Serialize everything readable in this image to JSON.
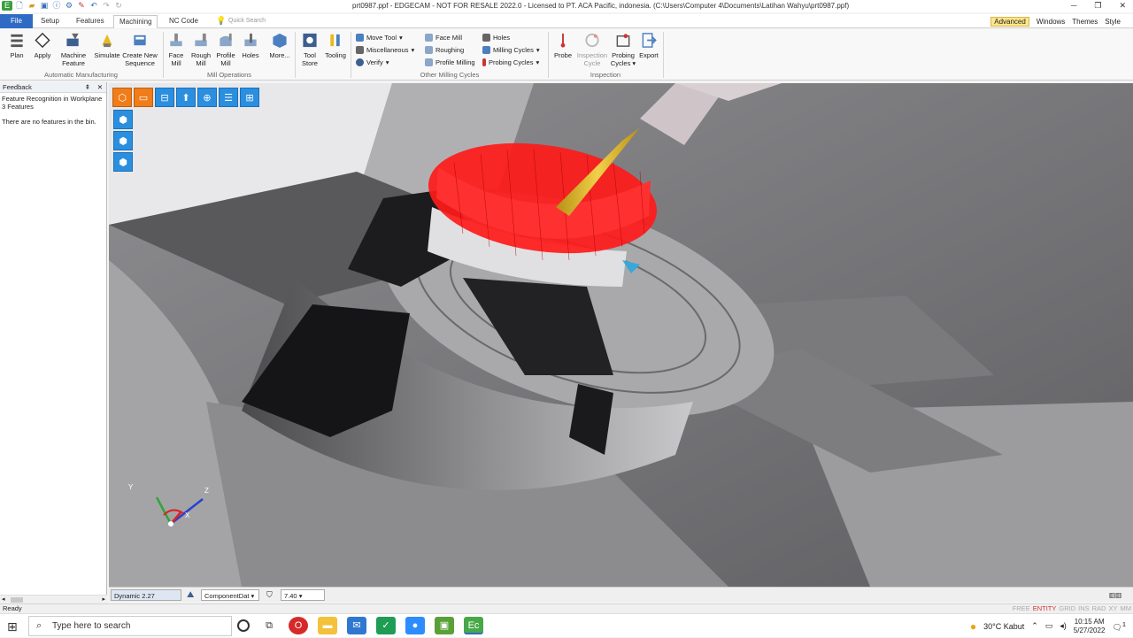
{
  "window": {
    "title": "prt0987.ppf - EDGECAM - NOT FOR RESALE 2022.0  - Licensed to PT. ACA Pacific, indonesia. (C:\\Users\\Computer 4\\Documents\\Latihan Wahyu\\prt0987.ppf)",
    "minimize": "─",
    "maximize": "❐",
    "close": "✕"
  },
  "tabs": {
    "file": "File",
    "setup": "Setup",
    "features": "Features",
    "machining": "Machining",
    "nc_code": "NC Code",
    "quick_search_placeholder": "Quick Search",
    "advanced": "Advanced",
    "windows": "Windows",
    "themes": "Themes",
    "style": "Style"
  },
  "ribbon": {
    "automatic": {
      "label": "Automatic Manufacturing",
      "plan": "Plan",
      "apply": "Apply",
      "machine_feature_1": "Machine",
      "machine_feature_2": "Feature",
      "simulate": "Simulate",
      "create_seq_1": "Create New",
      "create_seq_2": "Sequence"
    },
    "mill_ops": {
      "label": "Mill Operations",
      "face_mill_1": "Face",
      "face_mill_2": "Mill",
      "rough_mill_1": "Rough",
      "rough_mill_2": "Mill",
      "profile_mill_1": "Profile",
      "profile_mill_2": "Mill",
      "holes": "Holes",
      "more": "More..."
    },
    "tooling": {
      "tool_store_1": "Tool",
      "tool_store_2": "Store",
      "tooling": "Tooling"
    },
    "other_cycles": {
      "label": "Other Milling Cycles",
      "move_tool": "Move Tool",
      "miscellaneous": "Miscellaneous",
      "verify": "Verify",
      "face_mill": "Face Mill",
      "roughing": "Roughing",
      "profile_milling": "Profile Milling",
      "holes": "Holes",
      "milling_cycles": "Milling Cycles",
      "probing_cycles": "Probing Cycles"
    },
    "inspection": {
      "label": "Inspection",
      "probe": "Probe",
      "inspection_cycle_1": "Inspection",
      "inspection_cycle_2": "Cycle",
      "probing_cycles_1": "Probing",
      "probing_cycles_2": "Cycles",
      "export": "Export"
    }
  },
  "feedback": {
    "title": "Feedback",
    "pin": "⇞",
    "close": "✕",
    "line1": "Feature Recognition in Workplane",
    "line2": " 3 Features",
    "line3": "There are no features in the bin."
  },
  "bottom_bar": {
    "view_mode": "Dynamic 2.27",
    "layer": "ComponentDat",
    "value": "7.40"
  },
  "status": {
    "ready": "Ready",
    "flags": [
      "FREE",
      "ENTITY",
      "GRID",
      "INS",
      "RAD",
      "XY",
      "MM"
    ]
  },
  "taskbar": {
    "search_placeholder": "Type here to search",
    "weather": "30°C  Kabut",
    "time": "10:15 AM",
    "date": "5/27/2022",
    "notifications": "1"
  },
  "triad": {
    "x": "X",
    "y": "Y",
    "z": "Z"
  },
  "colors": {
    "accent": "#2f6bc4",
    "toolpath": "#ff1a1a",
    "tool": "#d8b42a",
    "view_button": "#2b8fe0"
  }
}
